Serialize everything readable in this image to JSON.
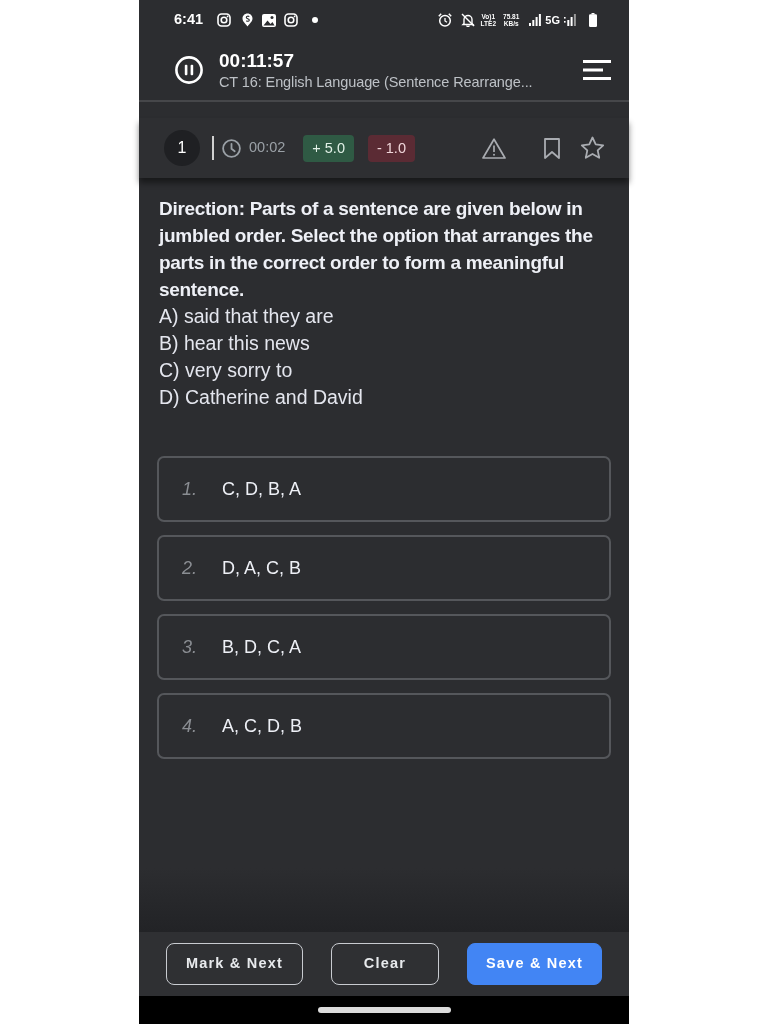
{
  "status_bar": {
    "time": "6:41",
    "volte": [
      "Vo)1",
      "LTE2"
    ],
    "speed": {
      "value": "75.81",
      "unit": "KB/s"
    },
    "network": "5G"
  },
  "header": {
    "timer": "00:11:57",
    "title": "CT 16: English Language (Sentence Rearrange..."
  },
  "question_bar": {
    "number": "1",
    "time_spent": "00:02",
    "positive_marks": "+ 5.0",
    "negative_marks": "- 1.0",
    "bookmarked": false,
    "starred": false
  },
  "question": {
    "direction": "Direction: Parts of a sentence are given below in jumbled order. Select the option that arranges the parts in the correct order to form a meaningful sentence.",
    "parts": [
      "A) said that they are",
      "B) hear this news",
      "C) very sorry to",
      "D) Catherine and David"
    ]
  },
  "options": [
    {
      "number": "1.",
      "text": "C, D, B, A",
      "selected": false
    },
    {
      "number": "2.",
      "text": "D, A, C, B",
      "selected": false
    },
    {
      "number": "3.",
      "text": "B, D, C, A",
      "selected": false
    },
    {
      "number": "4.",
      "text": "A, C, D, B",
      "selected": false
    }
  ],
  "actions": [
    {
      "label": "Mark & Next",
      "kind": "outline"
    },
    {
      "label": "Clear",
      "kind": "outline"
    },
    {
      "label": "Save & Next",
      "kind": "primary"
    }
  ]
}
